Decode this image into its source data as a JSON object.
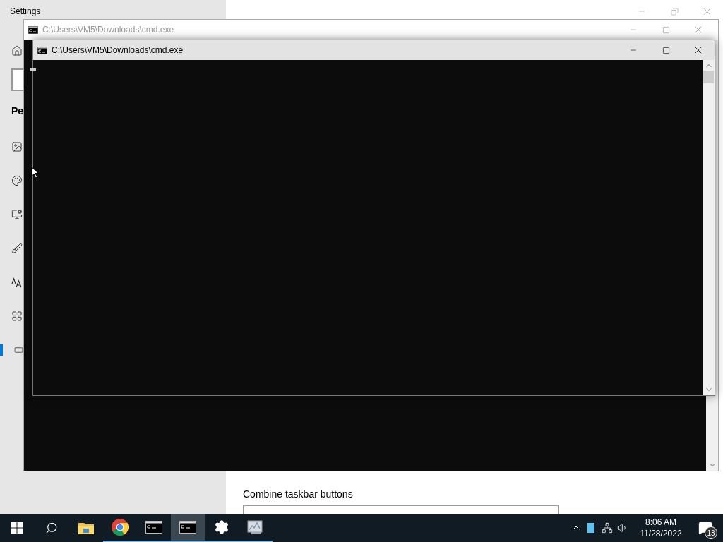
{
  "settings": {
    "title": "Settings",
    "section_heading": "Pe",
    "nav": [
      {
        "kind": "background",
        "selected": false
      },
      {
        "kind": "colors",
        "selected": false
      },
      {
        "kind": "lock",
        "selected": false
      },
      {
        "kind": "themes",
        "selected": false
      },
      {
        "kind": "fonts",
        "selected": false
      },
      {
        "kind": "start",
        "selected": false
      },
      {
        "kind": "taskbar",
        "selected": true
      }
    ],
    "combine_label": "Combine taskbar buttons"
  },
  "windows": [
    {
      "title": "C:\\Users\\VM5\\Downloads\\cmd.exe",
      "active": false
    },
    {
      "title": "C:\\Users\\VM5\\Downloads\\cmd.exe",
      "active": true
    }
  ],
  "taskbar": {
    "apps": [
      {
        "kind": "start",
        "running": false,
        "selected": false
      },
      {
        "kind": "search",
        "running": false,
        "selected": false
      },
      {
        "kind": "explorer",
        "running": false,
        "selected": false
      },
      {
        "kind": "chrome",
        "running": true,
        "selected": false
      },
      {
        "kind": "cmd",
        "running": true,
        "selected": false
      },
      {
        "kind": "cmd",
        "running": true,
        "selected": true
      },
      {
        "kind": "settings",
        "running": true,
        "selected": false
      },
      {
        "kind": "monitor",
        "running": true,
        "selected": false
      }
    ],
    "time": "8:06 AM",
    "date": "11/28/2022",
    "notifications": "13"
  }
}
